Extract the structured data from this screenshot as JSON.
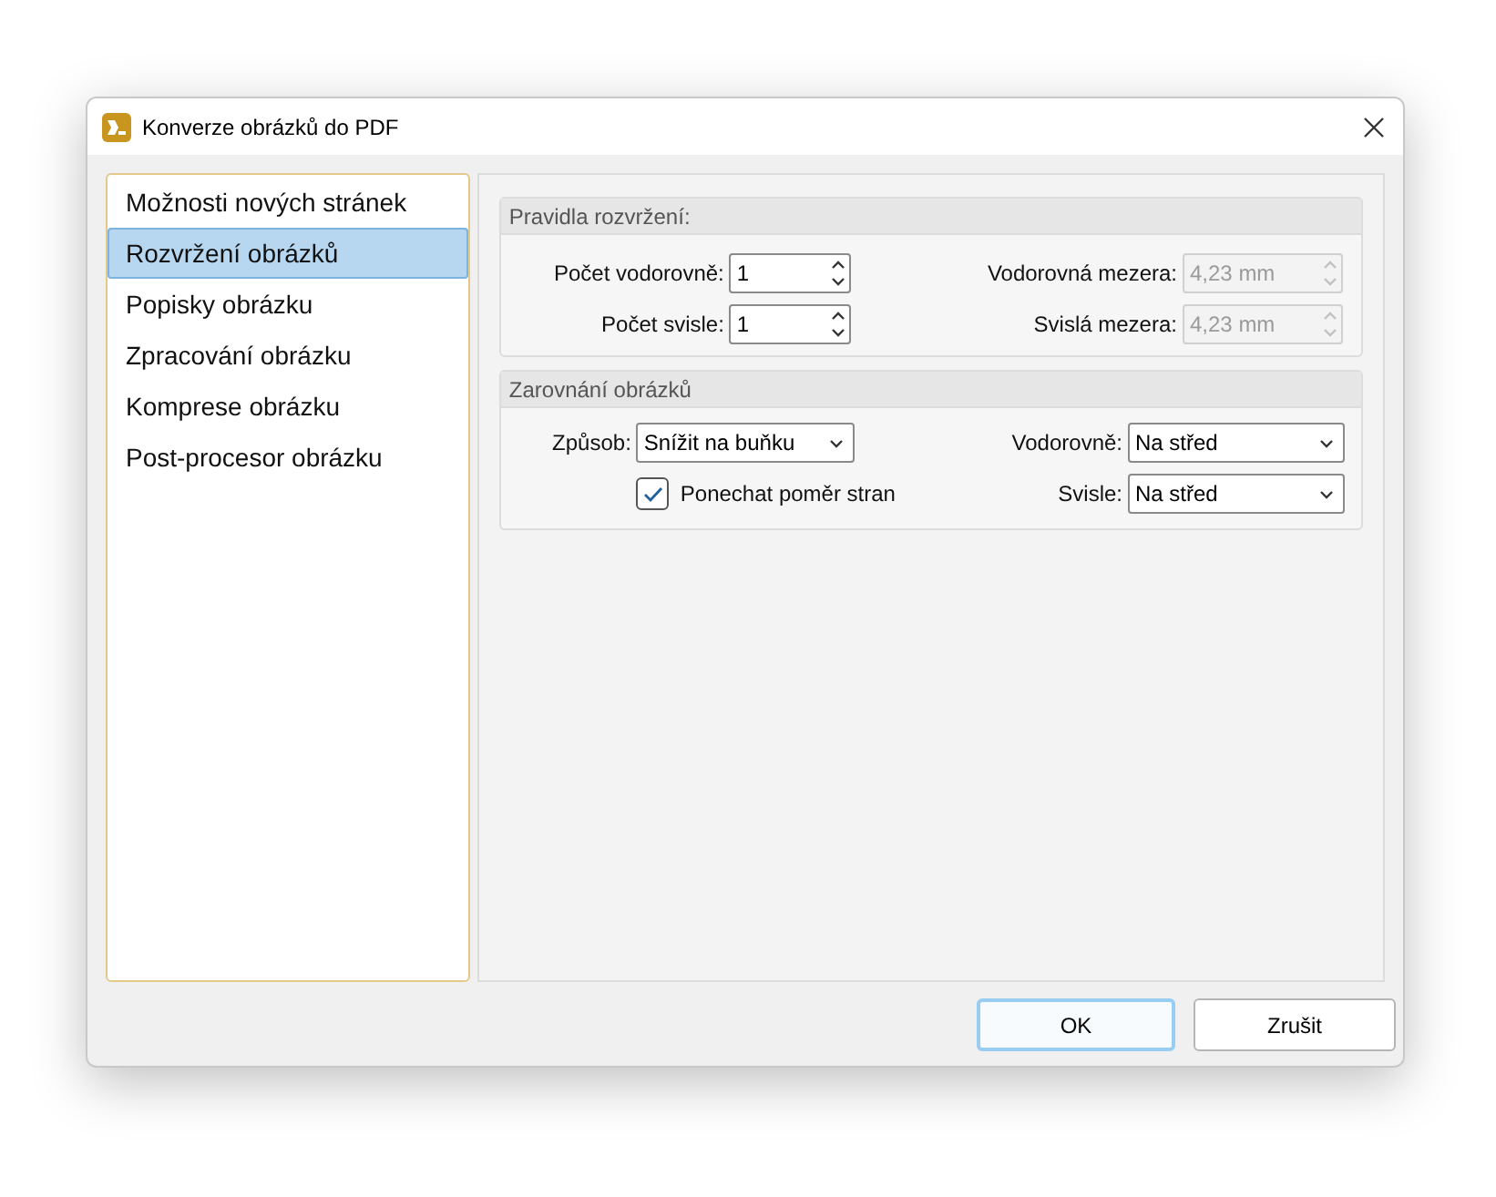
{
  "window": {
    "title": "Konverze obrázků do PDF"
  },
  "sidebar": {
    "items": [
      {
        "label": "Možnosti nových stránek",
        "selected": false
      },
      {
        "label": "Rozvržení obrázků",
        "selected": true
      },
      {
        "label": "Popisky obrázku",
        "selected": false
      },
      {
        "label": "Zpracování obrázku",
        "selected": false
      },
      {
        "label": "Komprese obrázku",
        "selected": false
      },
      {
        "label": "Post-procesor obrázku",
        "selected": false
      }
    ]
  },
  "groups": [
    {
      "title": "Pravidla rozvržení:",
      "left": [
        {
          "kind": "spin",
          "label": "Počet vodorovně:",
          "value": "1",
          "disabled": false
        },
        {
          "kind": "spin",
          "label": "Počet svisle:",
          "value": "1",
          "disabled": false
        }
      ],
      "right": [
        {
          "kind": "spin",
          "label": "Vodorovná mezera:",
          "value": "4,23 mm",
          "disabled": true
        },
        {
          "kind": "spin",
          "label": "Svislá mezera:",
          "value": "4,23 mm",
          "disabled": true
        }
      ]
    },
    {
      "title": "Zarovnání obrázků",
      "left": [
        {
          "kind": "combo",
          "label": "Způsob:",
          "value": "Snížit na buňku"
        },
        {
          "kind": "checkbox",
          "label": "Ponechat poměr stran",
          "checked": true
        }
      ],
      "right": [
        {
          "kind": "combo",
          "label": "Vodorovně:",
          "value": "Na střed"
        },
        {
          "kind": "combo",
          "label": "Svisle:",
          "value": "Na střed"
        }
      ]
    }
  ],
  "buttons": [
    {
      "label": "OK",
      "default": true
    },
    {
      "label": "Zrušit",
      "default": false
    }
  ]
}
